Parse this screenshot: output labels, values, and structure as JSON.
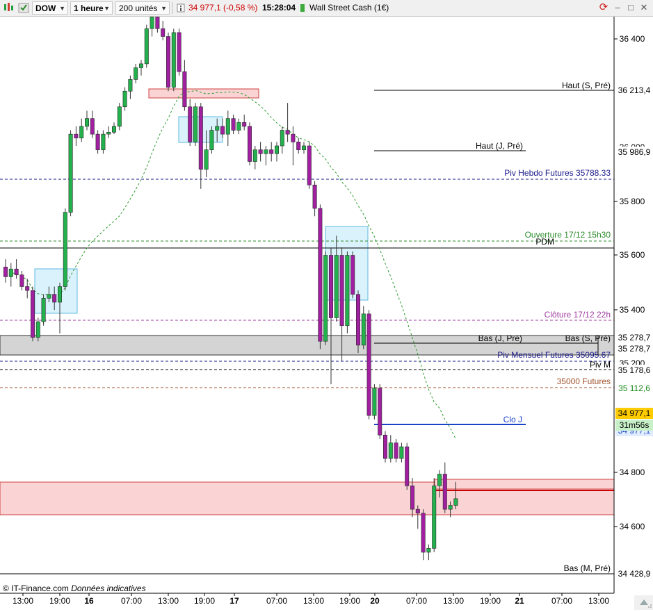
{
  "toolbar": {
    "symbol": "DOW",
    "timeframe": "1 heure",
    "units": "200 unités",
    "price_change": "34 977,1 (-0,58 %)",
    "time": "15:28:04",
    "instrument": "Wall Street Cash (1€)"
  },
  "colors": {
    "up": "#22b14c",
    "down": "#a020a0",
    "price_tag": "#ffcc00",
    "timer_tag": "#c8f0c8"
  },
  "chart_data": {
    "type": "candlestick",
    "ylim": [
      34410,
      36555
    ],
    "price_ticks": [
      "36 400",
      "35 800",
      "35 600",
      "35 400",
      "34 800",
      "34 600"
    ],
    "x_ticks": [
      "13:00",
      "19:00",
      "16",
      "07:00",
      "13:00",
      "19:00",
      "17",
      "07:00",
      "13:00",
      "19:00",
      "20",
      "07:00",
      "13:00",
      "19:00",
      "21",
      "07:00",
      "13:00"
    ],
    "candles": [
      [
        35570,
        35590,
        35530,
        35545
      ],
      [
        35545,
        35580,
        35520,
        35565
      ],
      [
        35565,
        35590,
        35540,
        35550
      ],
      [
        35550,
        35560,
        35510,
        35520
      ],
      [
        35520,
        35540,
        35490,
        35510
      ],
      [
        35510,
        35520,
        35380,
        35390
      ],
      [
        35390,
        35440,
        35380,
        35430
      ],
      [
        35430,
        35500,
        35420,
        35490
      ],
      [
        35490,
        35520,
        35480,
        35500
      ],
      [
        35500,
        35520,
        35460,
        35480
      ],
      [
        35480,
        35530,
        35400,
        35520
      ],
      [
        35520,
        35720,
        35510,
        35710
      ],
      [
        35710,
        35920,
        35700,
        35910
      ],
      [
        35910,
        35930,
        35880,
        35900
      ],
      [
        35900,
        35950,
        35890,
        35930
      ],
      [
        35930,
        35970,
        35920,
        35950
      ],
      [
        35950,
        35970,
        35900,
        35910
      ],
      [
        35910,
        35920,
        35860,
        35870
      ],
      [
        35870,
        35920,
        35860,
        35910
      ],
      [
        35910,
        35930,
        35900,
        35915
      ],
      [
        35915,
        35940,
        35910,
        35930
      ],
      [
        35930,
        35990,
        35920,
        35980
      ],
      [
        35980,
        36030,
        35970,
        36020
      ],
      [
        36020,
        36060,
        36000,
        36050
      ],
      [
        36050,
        36090,
        36040,
        36080
      ],
      [
        36080,
        36100,
        36060,
        36090
      ],
      [
        36090,
        36190,
        36080,
        36180
      ],
      [
        36180,
        36220,
        36160,
        36210
      ],
      [
        36210,
        36220,
        36170,
        36180
      ],
      [
        36180,
        36200,
        36150,
        36160
      ],
      [
        36160,
        36170,
        36020,
        36030
      ],
      [
        36030,
        36180,
        36020,
        36170
      ],
      [
        36170,
        36180,
        36060,
        36070
      ],
      [
        36070,
        36100,
        35970,
        35980
      ],
      [
        35980,
        36000,
        35880,
        35890
      ],
      [
        35890,
        35990,
        35880,
        35980
      ],
      [
        35980,
        35990,
        35770,
        35820
      ],
      [
        35820,
        35920,
        35800,
        35870
      ],
      [
        35870,
        35930,
        35860,
        35920
      ],
      [
        35920,
        35950,
        35890,
        35930
      ],
      [
        35930,
        35950,
        35900,
        35910
      ],
      [
        35910,
        35970,
        35880,
        35950
      ],
      [
        35950,
        35960,
        35910,
        35920
      ],
      [
        35920,
        35950,
        35910,
        35940
      ],
      [
        35940,
        35960,
        35920,
        35930
      ],
      [
        35930,
        35940,
        35830,
        35840
      ],
      [
        35840,
        35880,
        35820,
        35870
      ],
      [
        35870,
        35890,
        35840,
        35860
      ],
      [
        35860,
        35880,
        35830,
        35870
      ],
      [
        35870,
        35890,
        35840,
        35860
      ],
      [
        35860,
        35890,
        35840,
        35880
      ],
      [
        35880,
        35930,
        35860,
        35920
      ],
      [
        35920,
        35990,
        35890,
        35910
      ],
      [
        35910,
        35930,
        35830,
        35890
      ],
      [
        35890,
        35900,
        35860,
        35870
      ],
      [
        35870,
        35890,
        35860,
        35880
      ],
      [
        35880,
        35890,
        35770,
        35780
      ],
      [
        35780,
        35790,
        35700,
        35720
      ],
      [
        35720,
        35730,
        35360,
        35380
      ],
      [
        35380,
        35610,
        35370,
        35600
      ],
      [
        35600,
        35620,
        35270,
        35440
      ],
      [
        35440,
        35650,
        35430,
        35600
      ],
      [
        35600,
        35620,
        35330,
        35420
      ],
      [
        35420,
        35610,
        35400,
        35600
      ],
      [
        35600,
        35610,
        35490,
        35500
      ],
      [
        35500,
        35510,
        35350,
        35370
      ],
      [
        35370,
        35470,
        35360,
        35450
      ],
      [
        35450,
        35460,
        35180,
        35190
      ],
      [
        35190,
        35270,
        35180,
        35260
      ],
      [
        35260,
        35270,
        35130,
        35140
      ],
      [
        35140,
        35150,
        35070,
        35080
      ],
      [
        35080,
        35140,
        35070,
        35120
      ],
      [
        35120,
        35130,
        35070,
        35080
      ],
      [
        35080,
        35120,
        35070,
        35110
      ],
      [
        35110,
        35120,
        35000,
        35010
      ],
      [
        35010,
        35030,
        34930,
        34950
      ],
      [
        34950,
        34960,
        34900,
        34940
      ],
      [
        34940,
        34950,
        34820,
        34840
      ],
      [
        34840,
        34860,
        34820,
        34850
      ],
      [
        34850,
        35030,
        34840,
        35010
      ],
      [
        35010,
        35050,
        34980,
        35040
      ],
      [
        35040,
        35070,
        34940,
        34950
      ],
      [
        34950,
        34970,
        34930,
        34960
      ],
      [
        34960,
        35020,
        34950,
        34977.1
      ]
    ],
    "levels": [
      {
        "label": "Haut (S, Pré)",
        "price": 36213.4,
        "tag": "36 213,4"
      },
      {
        "label": "Haut (J, Pré)",
        "price": 35986.9,
        "tag": "35 986,9"
      },
      {
        "label": "Piv Hebdo Futures 35788.33",
        "price": 35880
      },
      {
        "label": "Ouverture 17/12 15h30",
        "price": 35655
      },
      {
        "label": "PDM",
        "price": 35630
      },
      {
        "label": "Clôture 17/12 22h",
        "price": 35370
      },
      {
        "label": "Bas (J, Pré)",
        "price": 35278.7,
        "tag": "35 278,7"
      },
      {
        "label": "Bas (S, Pré)",
        "price": 35278.7,
        "tag": "35 278,7"
      },
      {
        "label": "Piv Mensuel Futures 35095.67",
        "price": 35215
      },
      {
        "label": "Piv M",
        "price": 35178.6,
        "tag": "35 178,6"
      },
      {
        "label": "35000 Futures",
        "price": 35112.6,
        "tag": "35 112,6"
      },
      {
        "label": "Clo J",
        "price": 34977.1
      },
      {
        "label": "Bas (M, Pré)",
        "price": 34428.9,
        "tag": "34 428,9"
      }
    ],
    "current_price": "34 977,1",
    "timer": "31m56s",
    "partial_tag": "34 977,1",
    "tick_label_hidden": "36 000",
    "tick_label_hidden2": "35 200",
    "annotations": [
      "© IT-Finance.com",
      "Données indicatives"
    ]
  }
}
